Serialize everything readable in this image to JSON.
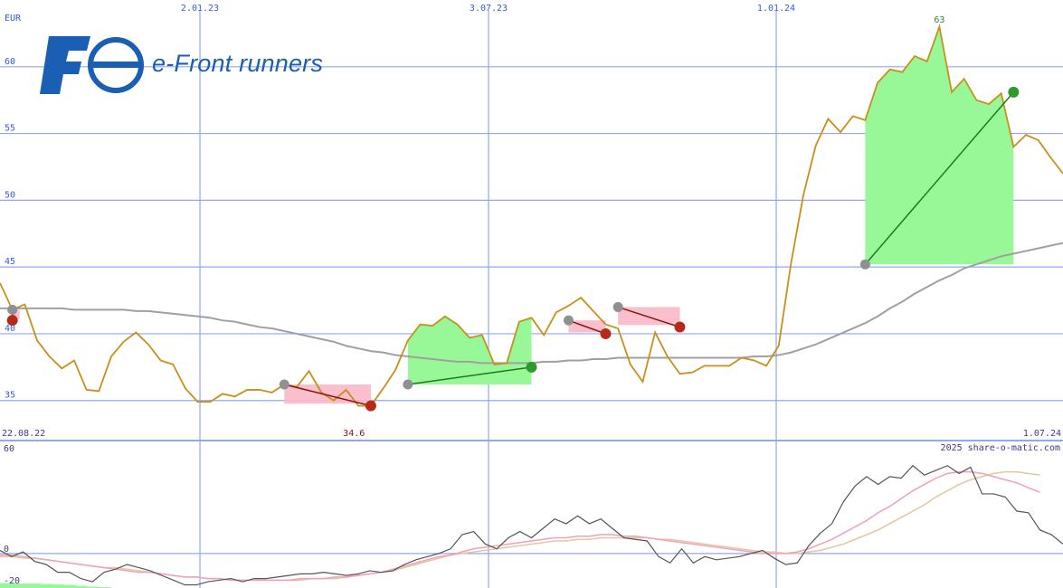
{
  "logo": {
    "text": "e-Front runners",
    "mark": "Fe"
  },
  "watermark": "2025 share-o-matic.com",
  "currency": "EUR",
  "markers": {
    "high_label": "63",
    "low_label": "34.6"
  },
  "x_labels": {
    "start": "22.08.22",
    "end": "1.07.24",
    "top": [
      "2.01.23",
      "3.07.23",
      "1.01.24"
    ]
  },
  "colors": {
    "price": "#c8901a",
    "sma": "#a0a0a0",
    "grid": "#8fa8f0",
    "gain": "#98f898",
    "loss": "#f8b8c8",
    "buy": "#2e9a2e",
    "sell": "#b82a18",
    "entry": "#909090",
    "osc_main": "#555555",
    "osc_sig1": "#f0a0b8",
    "osc_sig2": "#e0c8a0"
  },
  "chart_data": {
    "type": "line",
    "title": "",
    "ylabel": "EUR",
    "ylim": [
      32,
      65
    ],
    "yticks": [
      35,
      40,
      45,
      50,
      55,
      60
    ],
    "x_ticks": [
      "2.01.23",
      "3.07.23",
      "1.01.24"
    ],
    "x_range": [
      "22.08.22",
      "1.07.24"
    ],
    "series": [
      {
        "values": [
          43.8,
          41.8,
          42.2,
          39.5,
          38.3,
          37.4,
          38.0,
          35.8,
          35.7,
          38.3,
          39.4,
          40.1,
          39.2,
          38.0,
          37.7,
          35.9,
          34.9,
          34.9,
          35.5,
          35.3,
          35.8,
          35.8,
          35.6,
          36.2,
          36.0,
          37.2,
          35.6,
          35.0,
          35.8,
          34.6,
          34.6,
          35.9,
          37.3,
          39.5,
          40.7,
          40.6,
          41.3,
          40.7,
          39.7,
          39.9,
          37.7,
          37.8,
          40.9,
          41.2,
          39.9,
          41.6,
          42.1,
          42.7,
          41.7,
          40.7,
          40.4,
          37.7,
          36.4,
          40.1,
          38.3,
          37.0,
          37.1,
          37.6,
          37.6,
          37.6,
          38.2,
          38.0,
          37.6,
          39.1,
          45.3,
          50.4,
          54.1,
          56.1,
          55.1,
          56.3,
          56.0,
          58.8,
          59.8,
          59.6,
          60.8,
          60.4,
          63.0,
          58.1,
          59.1,
          57.5,
          57.2,
          58.0,
          54.0,
          54.9,
          54.5,
          53.2,
          52.0
        ]
      },
      {
        "values": [
          41.9,
          41.9,
          41.9,
          41.9,
          41.9,
          41.9,
          41.8,
          41.8,
          41.8,
          41.8,
          41.8,
          41.7,
          41.7,
          41.6,
          41.5,
          41.4,
          41.3,
          41.2,
          41.0,
          40.9,
          40.7,
          40.5,
          40.4,
          40.2,
          40.0,
          39.8,
          39.6,
          39.4,
          39.1,
          38.9,
          38.7,
          38.6,
          38.4,
          38.3,
          38.2,
          38.1,
          38.0,
          37.9,
          37.9,
          37.8,
          37.8,
          37.8,
          37.8,
          37.8,
          37.9,
          37.9,
          38.0,
          38.0,
          38.1,
          38.1,
          38.2,
          38.2,
          38.2,
          38.2,
          38.2,
          38.2,
          38.2,
          38.2,
          38.2,
          38.2,
          38.2,
          38.3,
          38.3,
          38.4,
          38.6,
          38.9,
          39.2,
          39.6,
          40.0,
          40.4,
          40.8,
          41.3,
          41.9,
          42.4,
          43.0,
          43.5,
          44.0,
          44.4,
          44.9,
          45.2,
          45.5,
          45.8,
          46.0,
          46.2,
          46.4,
          46.6,
          46.8
        ]
      }
    ],
    "trades": [
      {
        "entry_x": 1,
        "entry": 41.8,
        "exit_x": 1,
        "exit": 41.0,
        "result": "loss"
      },
      {
        "entry_x": 23,
        "entry": 36.2,
        "exit_x": 30,
        "exit": 34.6,
        "result": "loss"
      },
      {
        "entry_x": 33,
        "entry": 36.2,
        "exit_x": 43,
        "exit": 37.5,
        "result": "gain"
      },
      {
        "entry_x": 46,
        "entry": 41.0,
        "exit_x": 49,
        "exit": 40.0,
        "result": "loss"
      },
      {
        "entry_x": 50,
        "entry": 42.0,
        "exit_x": 55,
        "exit": 40.5,
        "result": "loss"
      },
      {
        "entry_x": 70,
        "entry": 45.2,
        "exit_x": 82,
        "exit": 58.1,
        "result": "gain"
      }
    ],
    "oscillator": {
      "ylim": [
        -22,
        72
      ],
      "yticks": [
        -20,
        0,
        60
      ],
      "main": [
        2,
        -2,
        1,
        -5,
        -7,
        -12,
        -12,
        -16,
        -18,
        -12,
        -10,
        -7,
        -9,
        -11,
        -14,
        -17,
        -20,
        -20,
        -18,
        -17,
        -16,
        -18,
        -16,
        -16,
        -15,
        -14,
        -13,
        -13,
        -12,
        -13,
        -14,
        -13,
        -11,
        -12,
        -11,
        -7,
        -4,
        -2,
        0,
        3,
        12,
        14,
        6,
        3,
        10,
        14,
        10,
        16,
        22,
        19,
        24,
        19,
        22,
        16,
        10,
        9,
        8,
        -2,
        -6,
        3,
        -6,
        -2,
        -4,
        -3,
        -2,
        0,
        2,
        -3,
        -7,
        -6,
        5,
        13,
        19,
        33,
        43,
        49,
        44,
        49,
        48,
        56,
        50,
        53,
        56,
        51,
        55,
        38,
        38,
        36,
        27,
        26,
        15,
        12,
        6
      ],
      "sig1": [
        -1,
        -1,
        -2,
        -3,
        -4,
        -5,
        -6,
        -7,
        -8,
        -9,
        -10,
        -11,
        -12,
        -12,
        -13,
        -14,
        -15,
        -15,
        -16,
        -16,
        -17,
        -17,
        -17,
        -17,
        -17,
        -17,
        -16,
        -16,
        -16,
        -15,
        -15,
        -14,
        -13,
        -12,
        -10,
        -8,
        -6,
        -4,
        -2,
        -1,
        1,
        3,
        4,
        5,
        6,
        7,
        8,
        9,
        10,
        10,
        11,
        11,
        12,
        12,
        11,
        11,
        10,
        9,
        8,
        7,
        6,
        5,
        4,
        3,
        2,
        1,
        0,
        0,
        0,
        1,
        3,
        6,
        9,
        13,
        17,
        21,
        26,
        30,
        35,
        40,
        44,
        48,
        51,
        52,
        52,
        51,
        49,
        47,
        45,
        42,
        39
      ],
      "sig2": [
        -2,
        -2,
        -3,
        -3,
        -4,
        -5,
        -6,
        -7,
        -8,
        -9,
        -9,
        -10,
        -11,
        -12,
        -13,
        -14,
        -15,
        -15,
        -16,
        -16,
        -17,
        -17,
        -17,
        -17,
        -17,
        -17,
        -17,
        -16,
        -16,
        -16,
        -15,
        -14,
        -13,
        -12,
        -11,
        -9,
        -7,
        -5,
        -3,
        -1,
        0,
        1,
        2,
        3,
        4,
        5,
        6,
        7,
        8,
        8,
        9,
        9,
        10,
        10,
        10,
        10,
        10,
        9,
        9,
        8,
        7,
        6,
        5,
        4,
        3,
        2,
        1,
        1,
        0,
        0,
        1,
        2,
        4,
        6,
        9,
        12,
        15,
        19,
        23,
        27,
        31,
        36,
        40,
        44,
        47,
        49,
        51,
        52,
        52,
        51,
        50
      ],
      "bars": [
        -14,
        -14,
        -13,
        -13,
        -12,
        -11,
        -10,
        -8,
        -6,
        -5,
        -3,
        -2,
        -1,
        0,
        0,
        0,
        0,
        0,
        0,
        0,
        0,
        0,
        0,
        0,
        -1,
        -1,
        0,
        0,
        0,
        0,
        0,
        0,
        0,
        0,
        0,
        0,
        0,
        0,
        0,
        0,
        0,
        0,
        0,
        0,
        0,
        0,
        0,
        0,
        0,
        0,
        0,
        0,
        0,
        0,
        0,
        0,
        0,
        0,
        0,
        0,
        0,
        0,
        0,
        0,
        0,
        0,
        0,
        0,
        0,
        0,
        0,
        0,
        -2,
        -2,
        0,
        0,
        0,
        -2,
        -2,
        -2,
        -2,
        0,
        0,
        0,
        0,
        0,
        0,
        0,
        0,
        0,
        0
      ]
    }
  }
}
